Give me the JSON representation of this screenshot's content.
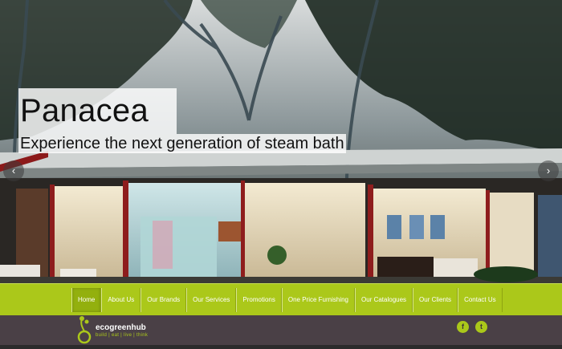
{
  "hero": {
    "title": "Panacea",
    "subtitle": "Experience the next generation of steam bath",
    "prev_arrow": "‹",
    "next_arrow": "›"
  },
  "nav": {
    "items": [
      {
        "label": "Home",
        "active": true
      },
      {
        "label": "About Us"
      },
      {
        "label": "Our Brands"
      },
      {
        "label": "Our Services"
      },
      {
        "label": "Promotions"
      },
      {
        "label": "One Price Furnishing"
      },
      {
        "label": "Our Catalogues"
      },
      {
        "label": "Our Clients"
      },
      {
        "label": "Contact Us"
      }
    ]
  },
  "footer": {
    "logo_name": "ecogreenhub",
    "logo_tagline": "build | eat | live | think",
    "facebook_glyph": "f",
    "twitter_glyph": "t"
  },
  "colors": {
    "accent_green": "#abc81a",
    "footer_bg": "#4a4046"
  },
  "icons": [
    "chevron-left-icon",
    "chevron-right-icon",
    "ecogreenhub-logo-icon",
    "facebook-icon",
    "twitter-icon"
  ]
}
